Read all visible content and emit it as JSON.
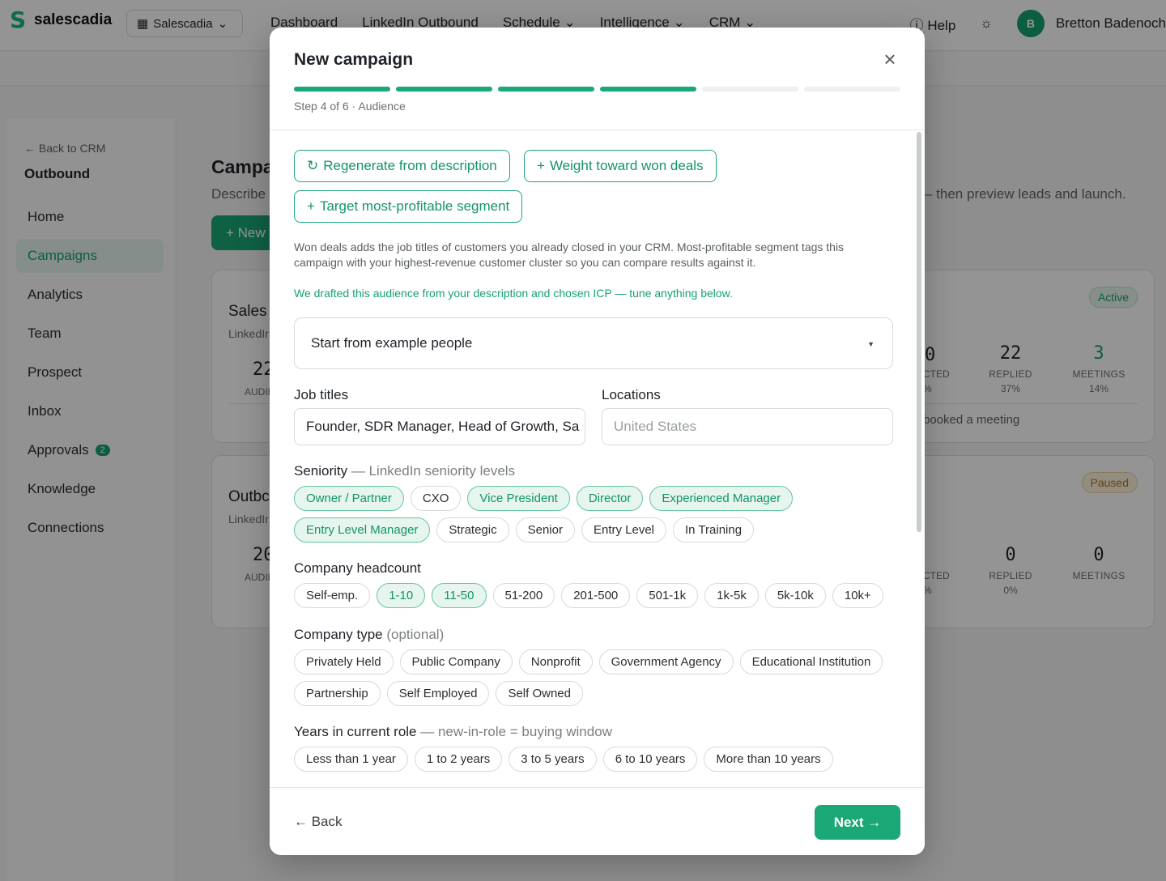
{
  "app": {
    "brand": "salescadia",
    "workspace": "Salescadia",
    "nav": [
      "Dashboard",
      "LinkedIn Outbound",
      "Schedule",
      "Intelligence",
      "CRM"
    ],
    "help": "Help",
    "user_initial": "B",
    "user_name": "Bretton Badenoch"
  },
  "sidebar": {
    "back": "← Back to CRM",
    "section": "Outbound",
    "items": [
      {
        "label": "Home"
      },
      {
        "label": "Campaigns"
      },
      {
        "label": "Analytics"
      },
      {
        "label": "Team"
      },
      {
        "label": "Prospect"
      },
      {
        "label": "Inbox"
      },
      {
        "label": "Approvals",
        "badge": "2"
      },
      {
        "label": "Knowledge"
      },
      {
        "label": "Connections"
      }
    ]
  },
  "page": {
    "title": "Campa",
    "desc": "Describe",
    "desc_right": "– then preview leads and launch.",
    "new_button": "+ New"
  },
  "cards": [
    {
      "title": "Sales",
      "sub": "LinkedIr",
      "num": "22",
      "lbl": "AUDIE",
      "badge": "Active",
      "frag_num": "0",
      "frag_lbl": "CTED",
      "frag_pct": "%",
      "replied": "22",
      "replied_lbl": "REPLIED",
      "replied_pct": "37%",
      "meetings": "3",
      "meetings_lbl": "MEETINGS",
      "meetings_pct": "14%",
      "foot": "booked a meeting"
    },
    {
      "title": "Outbc",
      "sub": "LinkedIr",
      "num": "20",
      "lbl": "AUDIE",
      "badge": "Paused",
      "frag_lbl": "CTED",
      "frag_pct": "%",
      "replied": "0",
      "replied_lbl": "REPLIED",
      "replied_pct": "0%",
      "meetings": "0",
      "meetings_lbl": "MEETINGS"
    }
  ],
  "modal": {
    "title": "New campaign",
    "step_text": "Step 4 of 6 · Audience",
    "steps_total": 6,
    "steps_done": 4,
    "actions": {
      "regenerate": "Regenerate from description",
      "weight": "Weight toward won deals",
      "target": "Target most-profitable segment"
    },
    "note": "Won deals adds the job titles of customers you already closed in your CRM. Most-profitable segment tags this campaign with your highest-revenue customer cluster so you can compare results against it.",
    "drafted_note": "We drafted this audience from your description and chosen ICP — tune anything below.",
    "example_select": "Start from example people",
    "job_titles": {
      "label": "Job titles",
      "value": "Founder, SDR Manager, Head of Growth, Sa"
    },
    "locations": {
      "label": "Locations",
      "placeholder": "United States"
    },
    "seniority": {
      "label": "Seniority",
      "hint": "— LinkedIn seniority levels",
      "options": [
        {
          "label": "Owner / Partner",
          "on": true
        },
        {
          "label": "CXO",
          "on": false
        },
        {
          "label": "Vice President",
          "on": true
        },
        {
          "label": "Director",
          "on": true
        },
        {
          "label": "Experienced Manager",
          "on": true
        },
        {
          "label": "Entry Level Manager",
          "on": true
        },
        {
          "label": "Strategic",
          "on": false
        },
        {
          "label": "Senior",
          "on": false
        },
        {
          "label": "Entry Level",
          "on": false
        },
        {
          "label": "In Training",
          "on": false
        }
      ]
    },
    "headcount": {
      "label": "Company headcount",
      "options": [
        {
          "label": "Self-emp.",
          "on": false
        },
        {
          "label": "1-10",
          "on": true
        },
        {
          "label": "11-50",
          "on": true
        },
        {
          "label": "51-200",
          "on": false
        },
        {
          "label": "201-500",
          "on": false
        },
        {
          "label": "501-1k",
          "on": false
        },
        {
          "label": "1k-5k",
          "on": false
        },
        {
          "label": "5k-10k",
          "on": false
        },
        {
          "label": "10k+",
          "on": false
        }
      ]
    },
    "company_type": {
      "label": "Company type",
      "hint": "(optional)",
      "options": [
        {
          "label": "Privately Held",
          "on": false
        },
        {
          "label": "Public Company",
          "on": false
        },
        {
          "label": "Nonprofit",
          "on": false
        },
        {
          "label": "Government Agency",
          "on": false
        },
        {
          "label": "Educational Institution",
          "on": false
        },
        {
          "label": "Partnership",
          "on": false
        },
        {
          "label": "Self Employed",
          "on": false
        },
        {
          "label": "Self Owned",
          "on": false
        }
      ]
    },
    "years_role": {
      "label": "Years in current role",
      "hint": "— new-in-role = buying window",
      "options": [
        {
          "label": "Less than 1 year",
          "on": false
        },
        {
          "label": "1 to 2 years",
          "on": false
        },
        {
          "label": "3 to 5 years",
          "on": false
        },
        {
          "label": "6 to 10 years",
          "on": false
        },
        {
          "label": "More than 10 years",
          "on": false
        }
      ]
    },
    "back": "← Back",
    "next": "Next →"
  },
  "colors": {
    "accent": "#1aa876",
    "chip_on_bg": "#e6f5ee",
    "overlay": "rgba(0,0,0,0.42)"
  }
}
